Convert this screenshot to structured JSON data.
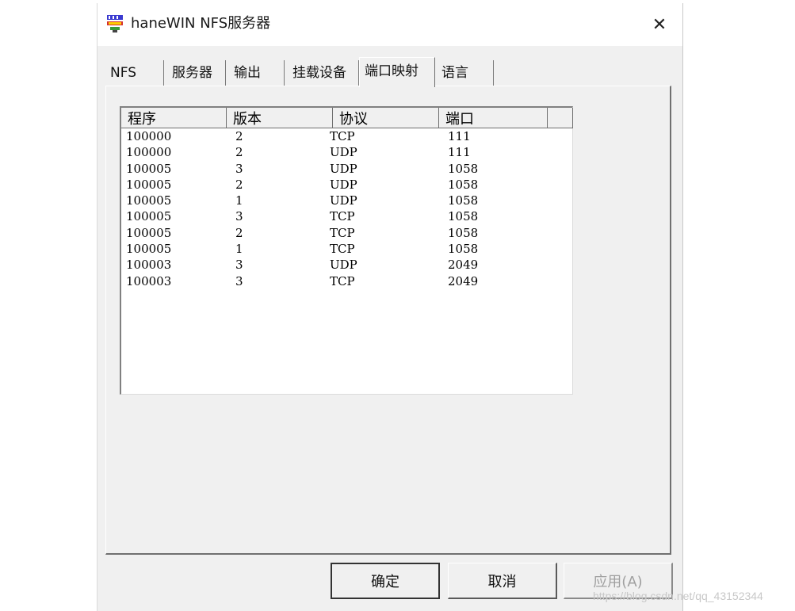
{
  "window": {
    "title": "haneWIN NFS服务器",
    "close_label": "✕"
  },
  "tabs": [
    {
      "label": "NFS",
      "active": false
    },
    {
      "label": "服务器",
      "active": false
    },
    {
      "label": "输出",
      "active": false
    },
    {
      "label": "挂载设备",
      "active": false
    },
    {
      "label": "端口映射",
      "active": true
    },
    {
      "label": "语言",
      "active": false
    }
  ],
  "table": {
    "columns": [
      "程序",
      "版本",
      "协议",
      "端口"
    ],
    "rows": [
      [
        "100000",
        "2",
        "TCP",
        "111"
      ],
      [
        "100000",
        "2",
        "UDP",
        "111"
      ],
      [
        "100005",
        "3",
        "UDP",
        "1058"
      ],
      [
        "100005",
        "2",
        "UDP",
        "1058"
      ],
      [
        "100005",
        "1",
        "UDP",
        "1058"
      ],
      [
        "100005",
        "3",
        "TCP",
        "1058"
      ],
      [
        "100005",
        "2",
        "TCP",
        "1058"
      ],
      [
        "100005",
        "1",
        "TCP",
        "1058"
      ],
      [
        "100003",
        "3",
        "UDP",
        "2049"
      ],
      [
        "100003",
        "3",
        "TCP",
        "2049"
      ]
    ]
  },
  "buttons": {
    "ok": "确定",
    "cancel": "取消",
    "apply": "应用(A)"
  },
  "watermark": "https://blog.csdn.net/qq_43152344",
  "icons": {
    "app": "nfs-app-icon",
    "close": "close-icon"
  }
}
